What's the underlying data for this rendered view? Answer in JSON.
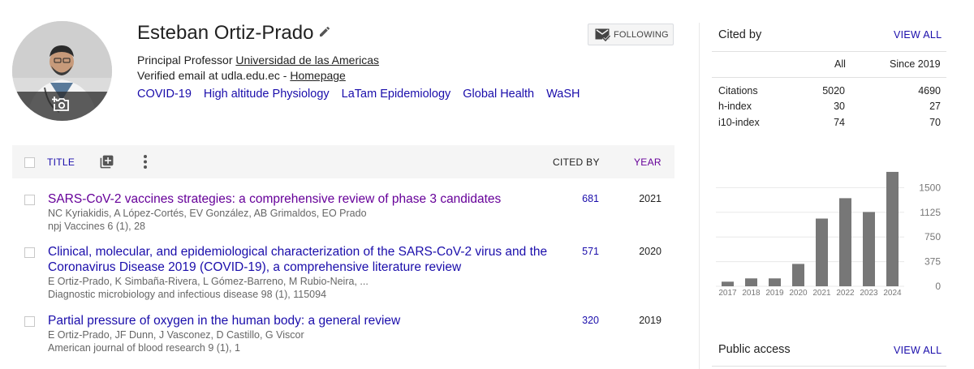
{
  "profile": {
    "name": "Esteban Ortiz-Prado",
    "position_prefix": "Principal Professor",
    "affiliation": "Universidad de las Americas",
    "email_text": "Verified email at udla.edu.ec - ",
    "homepage_label": "Homepage",
    "follow_label": "FOLLOWING",
    "interests": [
      "COVID-19",
      "High altitude Physiology",
      "LaTam Epidemiology",
      "Global Health",
      "WaSH"
    ]
  },
  "table": {
    "title_header": "TITLE",
    "cited_header": "CITED BY",
    "year_header": "YEAR"
  },
  "articles": [
    {
      "title": "SARS-CoV-2 vaccines strategies: a comprehensive review of phase 3 candidates",
      "authors": "NC Kyriakidis, A López-Cortés, EV González, AB Grimaldos, EO Prado",
      "source": "npj Vaccines 6 (1), 28",
      "cited_by": "681",
      "year": "2021",
      "visited": true
    },
    {
      "title": "Clinical, molecular, and epidemiological characterization of the SARS-CoV-2 virus and the Coronavirus Disease 2019 (COVID-19), a comprehensive literature review",
      "authors": "E Ortiz-Prado, K Simbaña-Rivera, L Gómez-Barreno, M Rubio-Neira, ...",
      "source": "Diagnostic microbiology and infectious disease 98 (1), 115094",
      "cited_by": "571",
      "year": "2020",
      "visited": false
    },
    {
      "title": "Partial pressure of oxygen in the human body: a general review",
      "authors": "E Ortiz-Prado, JF Dunn, J Vasconez, D Castillo, G Viscor",
      "source": "American journal of blood research 9 (1), 1",
      "cited_by": "320",
      "year": "2019",
      "visited": false
    }
  ],
  "cited_by": {
    "title": "Cited by",
    "view_all": "VIEW ALL",
    "col_all": "All",
    "col_since": "Since 2019",
    "rows": [
      {
        "label": "Citations",
        "all": "5020",
        "since": "4690"
      },
      {
        "label": "h-index",
        "all": "30",
        "since": "27"
      },
      {
        "label": "i10-index",
        "all": "74",
        "since": "70"
      }
    ]
  },
  "chart_data": {
    "type": "bar",
    "categories": [
      "2017",
      "2018",
      "2019",
      "2020",
      "2021",
      "2022",
      "2023",
      "2024"
    ],
    "values": [
      70,
      120,
      120,
      340,
      1030,
      1340,
      1130,
      1740
    ],
    "ylim": [
      0,
      1875
    ],
    "yticks": [
      "0",
      "375",
      "750",
      "1125",
      "1500"
    ],
    "bar_color": "#777777",
    "grid": true
  },
  "public_access": {
    "title": "Public access",
    "view_all": "VIEW ALL"
  },
  "colors": {
    "link": "#1a0dab",
    "visited": "#660099",
    "meta": "#666666"
  },
  "icons": [
    "camera-icon",
    "edit-icon",
    "following-icon",
    "add-column-icon",
    "more-vert-icon"
  ]
}
